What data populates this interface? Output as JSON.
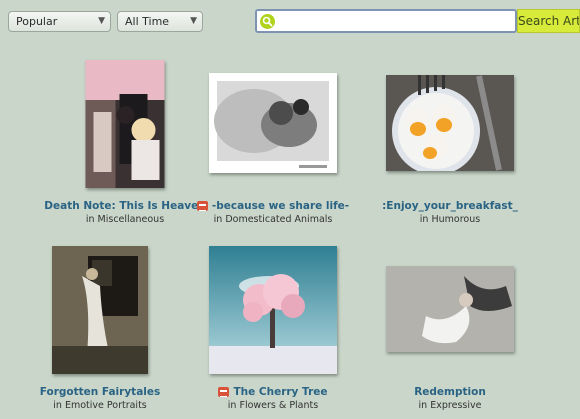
{
  "filters": {
    "sort": "Popular",
    "time": "All Time"
  },
  "search": {
    "value": "",
    "placeholder": "",
    "button_label": "Search Art"
  },
  "items": [
    {
      "title": "Death Note: This Is Heaven",
      "prefix": "in",
      "category": "Miscellaneous",
      "badge": false
    },
    {
      "title": "-because we share life-",
      "prefix": "in",
      "category": "Domesticated Animals",
      "badge": true
    },
    {
      "title": ":Enjoy_your_breakfast_",
      "prefix": "in",
      "category": "Humorous",
      "badge": false
    },
    {
      "title": "Forgotten Fairytales",
      "prefix": "in",
      "category": "Emotive Portraits",
      "badge": false
    },
    {
      "title": "The Cherry Tree",
      "prefix": "in",
      "category": "Flowers & Plants",
      "badge": true
    },
    {
      "title": "Redemption",
      "prefix": "in",
      "category": "Expressive",
      "badge": false
    }
  ],
  "colors": {
    "background": "#c9d6c9",
    "link": "#2a6384",
    "search_button": "#d8ea3a"
  }
}
